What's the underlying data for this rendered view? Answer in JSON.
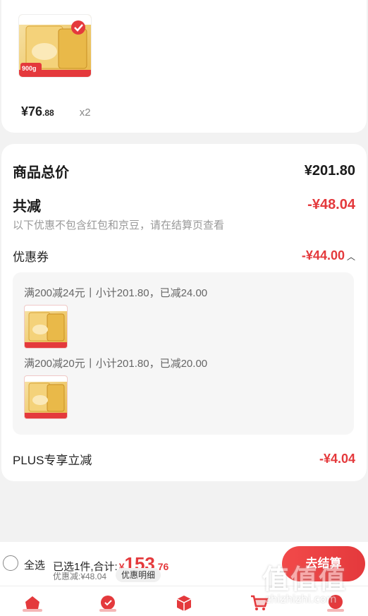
{
  "product": {
    "price_int": "¥76",
    "price_dec": ".88",
    "quantity": "x2",
    "badge_weight": "900g"
  },
  "summary": {
    "total_label": "商品总价",
    "total_value": "¥201.80",
    "reduce_label": "共减",
    "reduce_value": "-¥48.04",
    "note": "以下优惠不包含红包和京豆，请在结算页查看",
    "coupon_label": "优惠券",
    "coupon_value": "-¥44.00",
    "coupons": [
      {
        "text": "满200减24元丨小计201.80，已减24.00"
      },
      {
        "text": "满200减20元丨小计201.80，已减20.00"
      }
    ],
    "plus_label": "PLUS专享立减",
    "plus_value": "-¥4.04"
  },
  "checkout": {
    "select_all": "全选",
    "selected_prefix": "已选1件,合计:",
    "yuan_sign": "¥",
    "total_int": "153",
    "total_dec": ".76",
    "discount_line": "优惠减:¥48.04",
    "detail_button": "优惠明细",
    "checkout_button": "去结算"
  },
  "tabs": [
    {
      "icon": "home-icon"
    },
    {
      "icon": "new-icon"
    },
    {
      "icon": "box-icon"
    },
    {
      "icon": "cart-icon"
    },
    {
      "icon": "me-icon"
    }
  ],
  "watermark": {
    "big": "值值值",
    "small": "zhizhizhi.com"
  },
  "colors": {
    "accent": "#e4393c",
    "background": "#f2f2f2",
    "card": "#ffffff"
  }
}
